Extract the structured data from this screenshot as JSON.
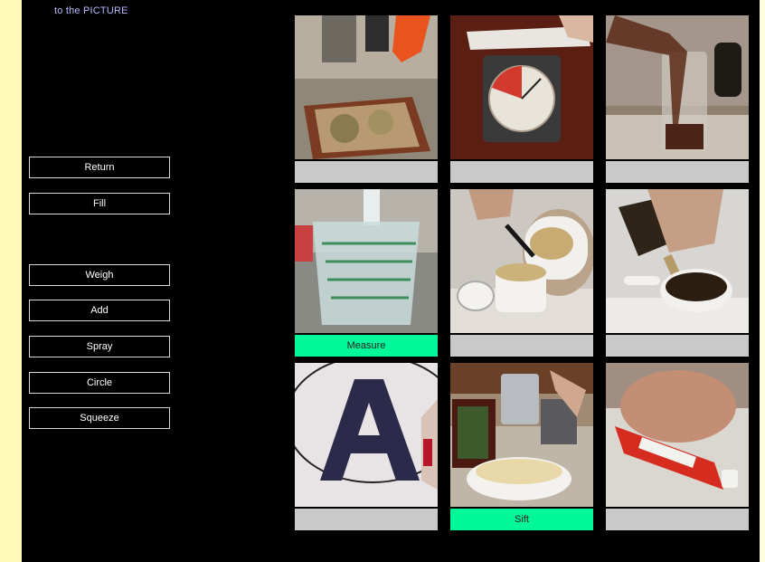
{
  "header": {
    "text": "to the PICTURE"
  },
  "buttons": {
    "return": "Return",
    "fill": "Fill",
    "weigh": "Weigh",
    "add": "Add",
    "spray": "Spray",
    "circle": "Circle",
    "squeeze": "Squeeze"
  },
  "cards": [
    {
      "caption": ""
    },
    {
      "caption": ""
    },
    {
      "caption": ""
    },
    {
      "caption": "Measure",
      "highlighted": true
    },
    {
      "caption": ""
    },
    {
      "caption": ""
    },
    {
      "caption": ""
    },
    {
      "caption": "Sift",
      "highlighted": true
    },
    {
      "caption": ""
    }
  ],
  "colors": {
    "screen_bg": "#000000",
    "page_bg": "#fffbd0",
    "caption_default": "#c9c9c9",
    "caption_highlight": "#00f79a",
    "header_text": "#b9b9ff"
  },
  "icons": [
    "spray-bottle-photo",
    "kitchen-scale-photo",
    "pouring-liquid-photo",
    "measuring-cup-photo",
    "brush-and-jar-photo",
    "shaker-bowl-photo",
    "letter-a-circle-photo",
    "flour-sifter-photo",
    "squeeze-tube-photo"
  ]
}
